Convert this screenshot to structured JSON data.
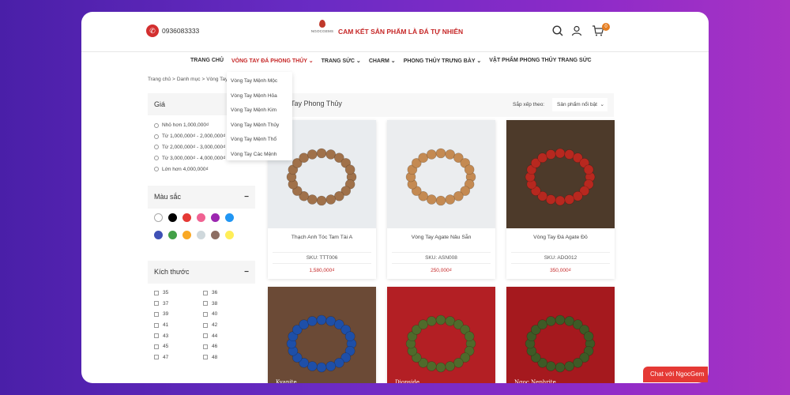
{
  "header": {
    "phone": "0936083333",
    "logo_text": "NGOCGEMS",
    "slogan": "CAM KẾT SẢN PHẨM LÀ ĐÁ TỰ NHIÊN",
    "cart_count": "0"
  },
  "nav": [
    {
      "label": "TRANG CHỦ"
    },
    {
      "label": "VÒNG TAY ĐÁ PHONG THỦY ⌄"
    },
    {
      "label": "TRANG SỨC ⌄"
    },
    {
      "label": "CHARM ⌄"
    },
    {
      "label": "PHONG THỦY TRƯNG BÀY ⌄"
    },
    {
      "label": "VẬT PHẨM PHONG THỦY TRANG SỨC"
    }
  ],
  "breadcrumb": {
    "home": "Trang chủ",
    "sep": ">",
    "category": "Danh mục",
    "current": "Vòng Tay"
  },
  "dropdown": [
    "Vòng Tay Mệnh Mộc",
    "Vòng Tay Mệnh Hỏa",
    "Vòng Tay Mệnh Kim",
    "Vòng Tay Mệnh Thủy",
    "Vòng Tay Mệnh Thổ",
    "Vòng Tay Các Mệnh"
  ],
  "filters": {
    "price_title": "Giá",
    "price_options": [
      "Nhỏ hơn 1,000,000₫",
      "Từ 1,000,000₫ - 2,000,000₫",
      "Từ 2,000,000₫ - 3,000,000₫",
      "Từ 3,000,000₫ - 4,000,000₫",
      "Lớn hơn 4,000,000₫"
    ],
    "color_title": "Màu sắc",
    "colors": [
      "#ffffff",
      "#000000",
      "#e53935",
      "#f06292",
      "#9c27b0",
      "#2196f3",
      "#3f51b5",
      "#43a047",
      "#f9a825",
      "#cfd8dc",
      "#8d6e63",
      "#ffee58"
    ],
    "size_title": "Kích thước",
    "sizes": [
      "35",
      "36",
      "37",
      "38",
      "39",
      "40",
      "41",
      "42",
      "43",
      "44",
      "45",
      "46",
      "47",
      "48"
    ]
  },
  "main": {
    "title": "Tay Phong Thủy",
    "sort_label": "Sắp xếp theo:",
    "sort_value": "Sản phẩm nổi bật"
  },
  "products": [
    {
      "name": "Thạch Anh Tóc Tam Tài A",
      "sku": "SKU: TTT006",
      "price": "1,580,000₫",
      "bg": "#e9ecef",
      "bead": "#a0714a"
    },
    {
      "name": "Vòng Tay Agate Nâu Sẫn",
      "sku": "SKU: ASN008",
      "price": "250,000₫",
      "bg": "#ebedef",
      "bead": "#c48a52"
    },
    {
      "name": "Vòng Tay Đá Agate Đỏ",
      "sku": "SKU: ADO012",
      "price": "350,000₫",
      "bg": "#4d3a2a",
      "bead": "#b7281f"
    },
    {
      "name": "",
      "sku": "",
      "price": "",
      "bg": "#6b4a36",
      "bead": "#1e4fa8",
      "img_label": "Kyanite"
    },
    {
      "name": "",
      "sku": "",
      "price": "",
      "bg": "#b31f24",
      "bead": "#4f6a2b",
      "img_label": "Diopside"
    },
    {
      "name": "",
      "sku": "",
      "price": "",
      "bg": "#a5191e",
      "bead": "#3e5a26",
      "img_label": "Ngoc Nephrite"
    }
  ],
  "chat": {
    "label": "Chat với NgocGem"
  }
}
